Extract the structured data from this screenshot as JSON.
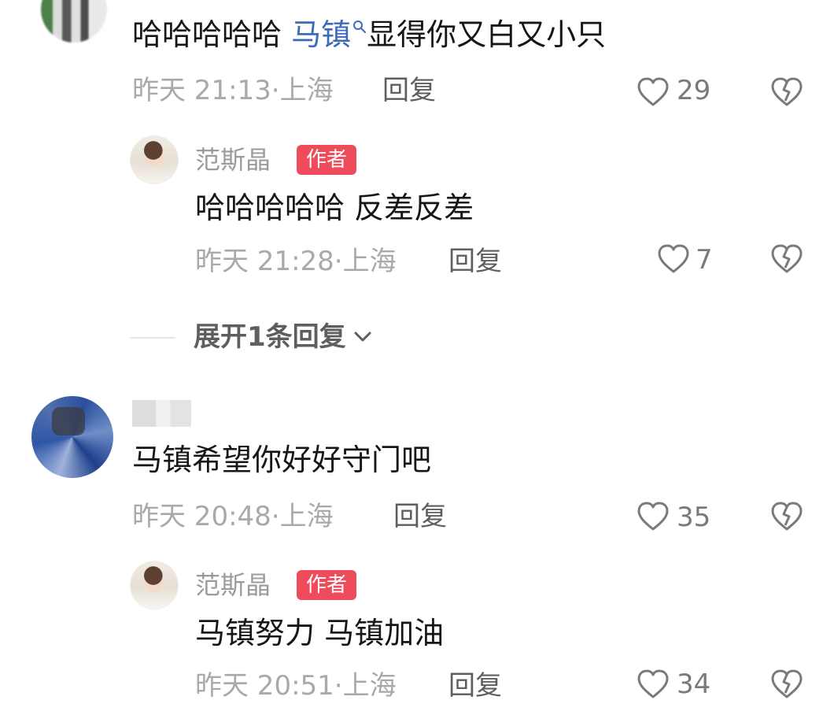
{
  "comments": [
    {
      "content_prefix": "哈哈哈哈哈",
      "mention": "马镇",
      "content_suffix": "显得你又白又小只",
      "time": "昨天 21:13",
      "location": "上海",
      "reply_label": "回复",
      "likes": "29",
      "replies": [
        {
          "author": "范斯晶",
          "badge": "作者",
          "content": "哈哈哈哈哈 反差反差",
          "time": "昨天 21:28",
          "location": "上海",
          "reply_label": "回复",
          "likes": "7"
        }
      ],
      "expand_label": "展开1条回复"
    },
    {
      "content": "马镇希望你好好守门吧",
      "time": "昨天 20:48",
      "location": "上海",
      "reply_label": "回复",
      "likes": "35",
      "replies": [
        {
          "author": "范斯晶",
          "badge": "作者",
          "content": "马镇努力 马镇加油",
          "time": "昨天 20:51",
          "location": "上海",
          "reply_label": "回复",
          "likes": "34"
        }
      ]
    }
  ],
  "dot_separator": "·",
  "colors": {
    "badge": "#ef4c5b",
    "mention": "#3b6bb8",
    "meta": "#a9a9a9",
    "text": "#161616"
  },
  "icons": {
    "like": "heart-outline-icon",
    "dislike": "broken-heart-icon",
    "search": "search-icon",
    "expand": "chevron-down-icon"
  }
}
